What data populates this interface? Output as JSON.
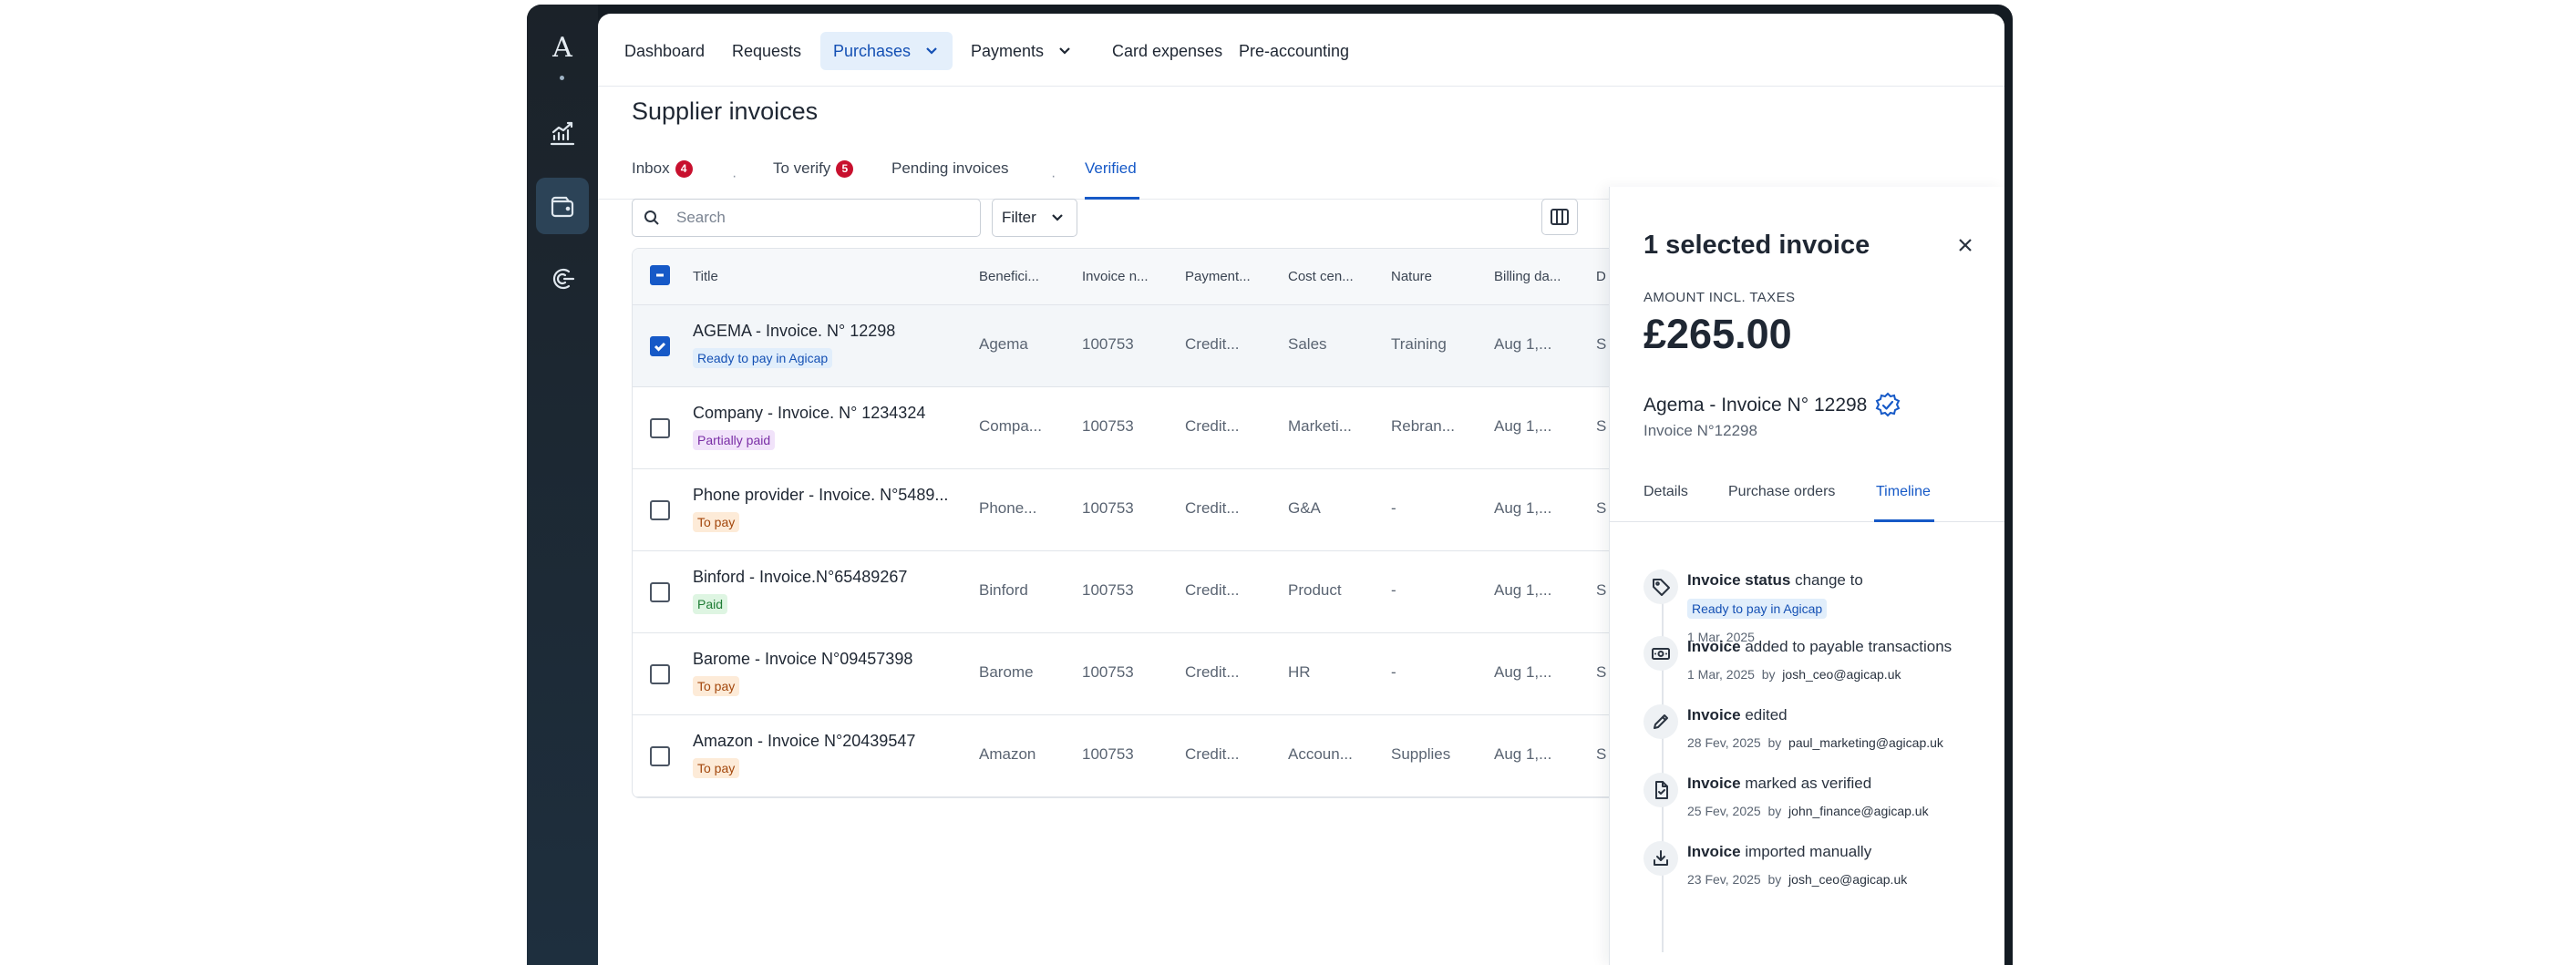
{
  "app": {
    "logo_letter": "A"
  },
  "nav": {
    "items": [
      {
        "label": "Dashboard"
      },
      {
        "label": "Requests"
      },
      {
        "label": "Purchases"
      },
      {
        "label": "Payments"
      },
      {
        "label": "Card expenses"
      },
      {
        "label": "Pre-accounting"
      }
    ],
    "active": "Purchases"
  },
  "page": {
    "title": "Supplier invoices",
    "tabs": [
      {
        "label": "Inbox",
        "badge": "4"
      },
      {
        "label": "To verify",
        "badge": "5"
      },
      {
        "label": "Pending invoices"
      },
      {
        "label": "Verified"
      }
    ],
    "separator": "·",
    "active_tab": "Verified"
  },
  "toolbar": {
    "search_placeholder": "Search",
    "filter_label": "Filter"
  },
  "table": {
    "columns": [
      "Title",
      "Benefici...",
      "Invoice n...",
      "Payment...",
      "Cost cen...",
      "Nature",
      "Billing da...",
      "D"
    ],
    "rows": [
      {
        "title": "AGEMA - Invoice. N° 12298",
        "status": "Ready to pay in Agicap",
        "status_type": "ready",
        "beneficiary": "Agema",
        "invoice_no": "100753",
        "payment": "Credit...",
        "cost_center": "Sales",
        "nature": "Training",
        "billing": "Aug 1,...",
        "d": "S",
        "checked": true
      },
      {
        "title": "Company - Invoice. N° 1234324",
        "status": "Partially paid",
        "status_type": "partial",
        "beneficiary": "Compa...",
        "invoice_no": "100753",
        "payment": "Credit...",
        "cost_center": "Marketi...",
        "nature": "Rebran...",
        "billing": "Aug 1,...",
        "d": "S",
        "checked": false
      },
      {
        "title": "Phone provider - Invoice. N°5489...",
        "status": "To pay",
        "status_type": "topay",
        "beneficiary": "Phone...",
        "invoice_no": "100753",
        "payment": "Credit...",
        "cost_center": "G&A",
        "nature": "-",
        "billing": "Aug 1,...",
        "d": "S",
        "checked": false
      },
      {
        "title": "Binford - Invoice.N°65489267",
        "status": "Paid",
        "status_type": "paid",
        "beneficiary": "Binford",
        "invoice_no": "100753",
        "payment": "Credit...",
        "cost_center": "Product",
        "nature": "-",
        "billing": "Aug 1,...",
        "d": "S",
        "checked": false
      },
      {
        "title": "Barome - Invoice N°09457398",
        "status": "To pay",
        "status_type": "topay",
        "beneficiary": "Barome",
        "invoice_no": "100753",
        "payment": "Credit...",
        "cost_center": "HR",
        "nature": "-",
        "billing": "Aug 1,...",
        "d": "S",
        "checked": false
      },
      {
        "title": "Amazon - Invoice N°20439547",
        "status": "To pay",
        "status_type": "topay",
        "beneficiary": "Amazon",
        "invoice_no": "100753",
        "payment": "Credit...",
        "cost_center": "Accoun...",
        "nature": "Supplies",
        "billing": "Aug 1,...",
        "d": "S",
        "checked": false
      }
    ]
  },
  "panel": {
    "title": "1 selected invoice",
    "amount_label": "AMOUNT INCL. TAXES",
    "amount": "£265.00",
    "invoice_name": "Agema - Invoice N° 12298",
    "invoice_sub": "Invoice N°12298",
    "tabs": [
      "Details",
      "Purchase orders",
      "Timeline"
    ],
    "active_tab": "Timeline",
    "timeline": [
      {
        "icon": "tag-icon",
        "bold": "Invoice status",
        "rest": " change to",
        "status": "Ready to pay in Agicap",
        "date": "1 Mar, 2025",
        "by": "",
        "user": ""
      },
      {
        "icon": "money-icon",
        "bold": "Invoice",
        "rest": " added to payable transactions",
        "status": "",
        "date": "1 Mar, 2025",
        "by": "by",
        "user": "josh_ceo@agicap.uk"
      },
      {
        "icon": "pencil-icon",
        "bold": "Invoice",
        "rest": " edited",
        "status": "",
        "date": "28 Fev, 2025",
        "by": "by",
        "user": "paul_marketing@agicap.uk"
      },
      {
        "icon": "file-check-icon",
        "bold": "Invoice",
        "rest": " marked as verified",
        "status": "",
        "date": "25 Fev, 2025",
        "by": "by",
        "user": "john_finance@agicap.uk"
      },
      {
        "icon": "import-icon",
        "bold": "Invoice",
        "rest": " imported manually",
        "status": "",
        "date": "23 Fev, 2025",
        "by": "by",
        "user": "josh_ceo@agicap.uk"
      }
    ]
  }
}
